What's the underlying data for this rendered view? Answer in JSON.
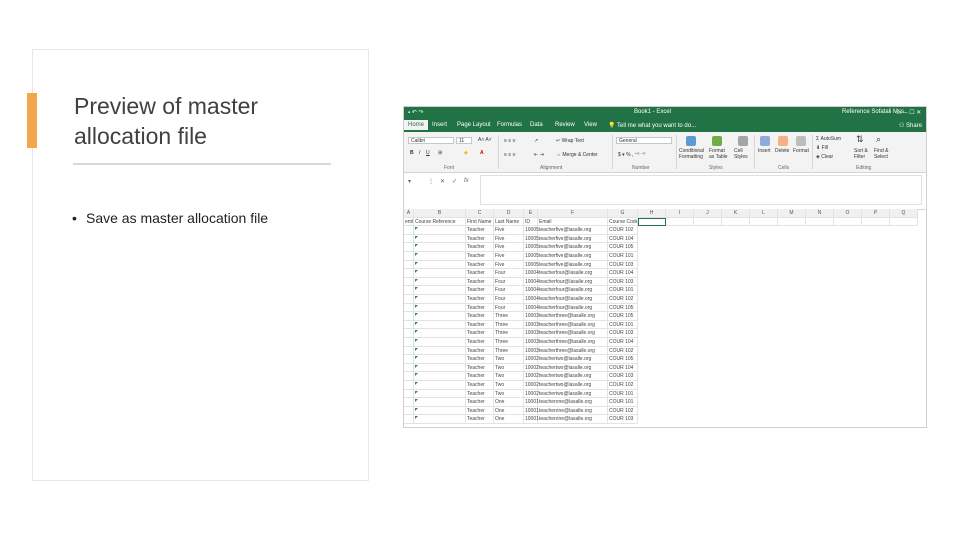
{
  "slide": {
    "title_line1": "Preview of master",
    "title_line2": "allocation file",
    "bullet": "Save as master allocation file"
  },
  "colors": {
    "accent": "#f2a74a",
    "excel_green": "#217346"
  },
  "excel": {
    "title": "Book1 - Excel",
    "account": "Reference Sofatali Mss",
    "share": "Share",
    "tabs": [
      "Home",
      "Insert",
      "Page Layout",
      "Formulas",
      "Data",
      "Review",
      "View"
    ],
    "tell_me": "Tell me what you want to do...",
    "font_name": "Calibri",
    "font_size": "11",
    "wrap_text": "Wrap Text",
    "merge_center": "Merge & Center",
    "number_format": "General",
    "conditional_formatting": "Conditional Formatting",
    "format_as_table": "Format as Table",
    "cell_styles": "Cell Styles",
    "insert": "Insert",
    "delete": "Delete",
    "format": "Format",
    "autosum": "AutoSum",
    "fill": "Fill",
    "clear": "Clear",
    "sort_filter": "Sort & Filter",
    "find_select": "Find & Select",
    "groups": [
      "Font",
      "Alignment",
      "Number",
      "Styles",
      "Cells",
      "Editing"
    ],
    "fx": "fx",
    "column_letters": [
      "A",
      "B",
      "C",
      "D",
      "E",
      "F",
      "G",
      "H",
      "I",
      "J",
      "K",
      "L",
      "M",
      "N",
      "O",
      "P",
      "Q"
    ],
    "header_row": [
      "enti",
      "Course Reference",
      "First Name",
      "Last Name",
      "ID",
      "Email",
      "Course Code",
      "",
      "",
      "",
      "",
      "",
      "",
      "",
      "",
      "",
      ""
    ],
    "rows": [
      [
        "Teacher",
        "Five",
        "10005",
        "teacherfive@lasalle.org",
        "COUR 102"
      ],
      [
        "Teacher",
        "Five",
        "10005",
        "teacherfive@lasalle.org",
        "COUR 104"
      ],
      [
        "Teacher",
        "Five",
        "10005",
        "teacherfive@lasalle.org",
        "COUR 105"
      ],
      [
        "Teacher",
        "Five",
        "10005",
        "teacherfive@lasalle.org",
        "COUR 101"
      ],
      [
        "Teacher",
        "Five",
        "10005",
        "teacherfive@lasalle.org",
        "COUR 103"
      ],
      [
        "Teacher",
        "Four",
        "10004",
        "teacherfour@lasalle.org",
        "COUR 104"
      ],
      [
        "Teacher",
        "Four",
        "10004",
        "teacherfour@lasalle.org",
        "COUR 103"
      ],
      [
        "Teacher",
        "Four",
        "10004",
        "teacherfour@lasalle.org",
        "COUR 101"
      ],
      [
        "Teacher",
        "Four",
        "10004",
        "teacherfour@lasalle.org",
        "COUR 102"
      ],
      [
        "Teacher",
        "Four",
        "10004",
        "teacherfour@lasalle.org",
        "COUR 105"
      ],
      [
        "Teacher",
        "Three",
        "10003",
        "teacherthree@lasalle.org",
        "COUR 105"
      ],
      [
        "Teacher",
        "Three",
        "10003",
        "teacherthree@lasalle.org",
        "COUR 101"
      ],
      [
        "Teacher",
        "Three",
        "10003",
        "teacherthree@lasalle.org",
        "COUR 103"
      ],
      [
        "Teacher",
        "Three",
        "10003",
        "teacherthree@lasalle.org",
        "COUR 104"
      ],
      [
        "Teacher",
        "Three",
        "10003",
        "teacherthree@lasalle.org",
        "COUR 102"
      ],
      [
        "Teacher",
        "Two",
        "10002",
        "teachertwo@lasalle.org",
        "COUR 105"
      ],
      [
        "Teacher",
        "Two",
        "10002",
        "teachertwo@lasalle.org",
        "COUR 104"
      ],
      [
        "Teacher",
        "Two",
        "10002",
        "teachertwo@lasalle.org",
        "COUR 103"
      ],
      [
        "Teacher",
        "Two",
        "10002",
        "teachertwo@lasalle.org",
        "COUR 102"
      ],
      [
        "Teacher",
        "Two",
        "10002",
        "teachertwo@lasalle.org",
        "COUR 101"
      ],
      [
        "Teacher",
        "One",
        "10001",
        "teacherone@lasalle.org",
        "COUR 101"
      ],
      [
        "Teacher",
        "One",
        "10001",
        "teacherone@lasalle.org",
        "COUR 102"
      ],
      [
        "Teacher",
        "One",
        "10001",
        "teacherone@lasalle.org",
        "COUR 103"
      ]
    ]
  }
}
